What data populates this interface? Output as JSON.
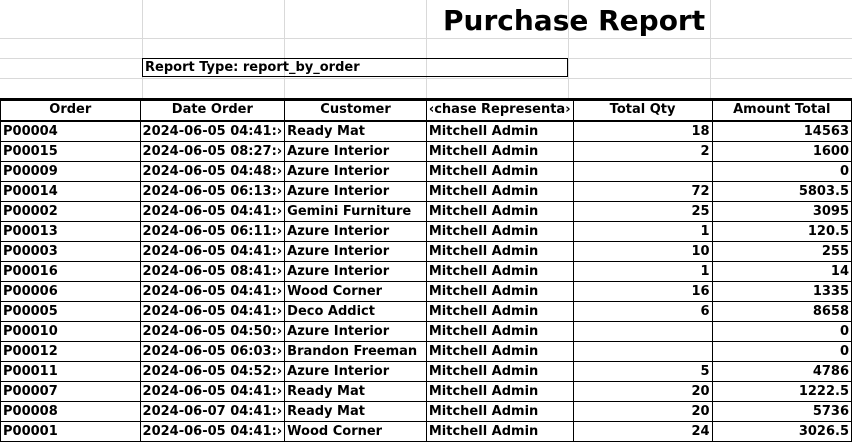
{
  "title": "Purchase Report",
  "report_type": "Report Type: report_by_order",
  "columns": [
    "Order",
    "Date Order",
    "Customer",
    "‹chase Representa›",
    "Total Qty",
    "Amount Total"
  ],
  "rows": [
    [
      "P00004",
      "2024-06-05 04:41:›",
      "Ready Mat",
      "Mitchell Admin",
      "18",
      "14563"
    ],
    [
      "P00015",
      "2024-06-05 08:27:›",
      "Azure Interior",
      "Mitchell Admin",
      "2",
      "1600"
    ],
    [
      "P00009",
      "2024-06-05 04:48:›",
      "Azure Interior",
      "Mitchell Admin",
      "",
      "0"
    ],
    [
      "P00014",
      "2024-06-05 06:13:›",
      "Azure Interior",
      "Mitchell Admin",
      "72",
      "5803.5"
    ],
    [
      "P00002",
      "2024-06-05 04:41:›",
      "Gemini Furniture",
      "Mitchell Admin",
      "25",
      "3095"
    ],
    [
      "P00013",
      "2024-06-05 06:11:›",
      "Azure Interior",
      "Mitchell Admin",
      "1",
      "120.5"
    ],
    [
      "P00003",
      "2024-06-05 04:41:›",
      "Azure Interior",
      "Mitchell Admin",
      "10",
      "255"
    ],
    [
      "P00016",
      "2024-06-05 08:41:›",
      "Azure Interior",
      "Mitchell Admin",
      "1",
      "14"
    ],
    [
      "P00006",
      "2024-06-05 04:41:›",
      "Wood Corner",
      "Mitchell Admin",
      "16",
      "1335"
    ],
    [
      "P00005",
      "2024-06-05 04:41:›",
      "Deco Addict",
      "Mitchell Admin",
      "6",
      "8658"
    ],
    [
      "P00010",
      "2024-06-05 04:50:›",
      "Azure Interior",
      "Mitchell Admin",
      "",
      "0"
    ],
    [
      "P00012",
      "2024-06-05 06:03:›",
      "Brandon Freeman",
      "Mitchell Admin",
      "",
      "0"
    ],
    [
      "P00011",
      "2024-06-05 04:52:›",
      "Azure Interior",
      "Mitchell Admin",
      "5",
      "4786"
    ],
    [
      "P00007",
      "2024-06-05 04:41:›",
      "Ready Mat",
      "Mitchell Admin",
      "20",
      "1222.5"
    ],
    [
      "P00008",
      "2024-06-07 04:41:›",
      "Ready Mat",
      "Mitchell Admin",
      "20",
      "5736"
    ],
    [
      "P00001",
      "2024-06-05 04:41:›",
      "Wood Corner",
      "Mitchell Admin",
      "24",
      "3026.5"
    ]
  ]
}
